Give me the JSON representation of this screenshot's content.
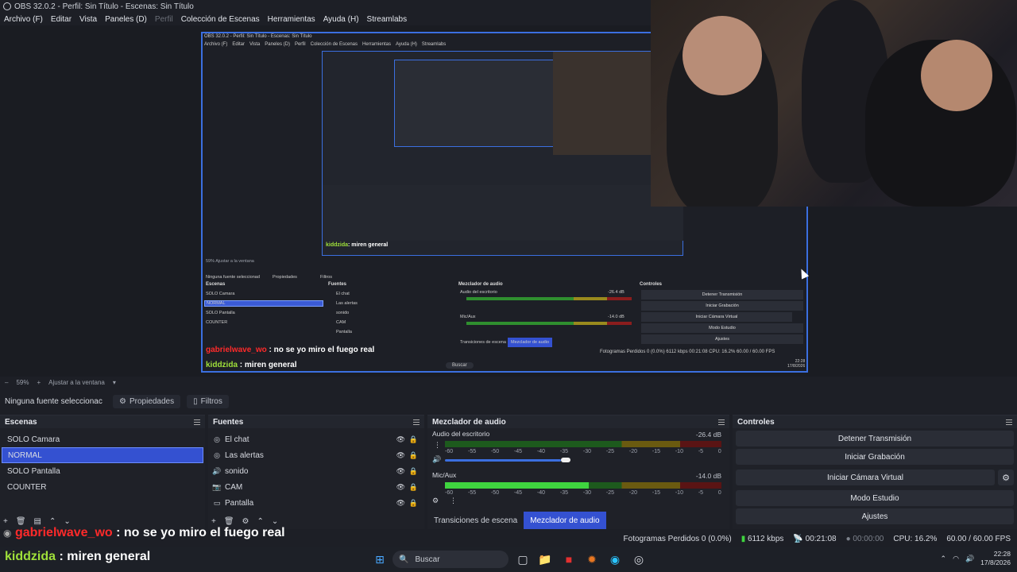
{
  "window": {
    "title": "OBS 32.0.2 - Perfil: Sin Título - Escenas: Sin Título"
  },
  "menu": [
    {
      "label": "Archivo (F)",
      "disabled": false
    },
    {
      "label": "Editar",
      "disabled": false
    },
    {
      "label": "Vista",
      "disabled": false
    },
    {
      "label": "Paneles (D)",
      "disabled": false
    },
    {
      "label": "Perfil",
      "disabled": true
    },
    {
      "label": "Colección de Escenas",
      "disabled": false
    },
    {
      "label": "Herramientas",
      "disabled": false
    },
    {
      "label": "Ayuda (H)",
      "disabled": false
    },
    {
      "label": "Streamlabs",
      "disabled": false
    }
  ],
  "nested": {
    "title": "OBS 32.0.2 - Perfil: Sin Título - Escenas: Sin Título",
    "menu": [
      "Archivo (F)",
      "Editar",
      "Vista",
      "Paneles (D)",
      "Perfil",
      "Colección de Escenas",
      "Herramientas",
      "Ayuda (H)",
      "Streamlabs"
    ],
    "zoom": "59%",
    "fit": "Ajustar a la ventana",
    "no_source": "Ninguna fuente seleccionad",
    "props": "Propiedades",
    "filters": "Filtros",
    "scenes_title": "Escenas",
    "scenes": [
      "SOLO Camara",
      "NORMAL",
      "SOLO Pantalla",
      "COUNTER"
    ],
    "sources_title": "Fuentes",
    "sources": [
      "El chat",
      "Las alertas",
      "sonido",
      "CAM",
      "Pantalla"
    ],
    "mixer_title": "Mezclador de audio",
    "desktop_audio": "Audio del escritorio",
    "desktop_db": "-26.4 dB",
    "mic": "Mic/Aux",
    "mic_db": "-14.0 dB",
    "tab_transitions": "Transiciones de escena",
    "tab_mixer": "Mezclador de audio",
    "controls_title": "Controles",
    "controls": [
      "Detener Transmisión",
      "Iniciar Grabación",
      "Iniciar Cámara Virtual",
      "Modo Estudio",
      "Ajustes"
    ],
    "chat1_user": "gabrielwave_wo",
    "chat1_msg": ": no se yo miro el fuego real",
    "chat2_user": "kiddzida",
    "chat2_msg": ": miren general",
    "status": "Fotogramas Perdidos 0 (0.0%)   6112 kbps   00:21:08   CPU: 16.2%   60.00 / 60.00 FPS",
    "search": "Buscar",
    "time": "22:28",
    "date": "17/8/2026"
  },
  "zoombar": {
    "zoom": "59%",
    "plus": "+",
    "minus": "–",
    "fit": "Ajustar a la ventana"
  },
  "source_toolbar": {
    "no_source": "Ninguna fuente seleccionac",
    "properties": "Propiedades",
    "filters": "Filtros"
  },
  "scenes": {
    "title": "Escenas",
    "items": [
      "SOLO Camara",
      "NORMAL",
      "SOLO Pantalla",
      "COUNTER"
    ],
    "selected_index": 1
  },
  "sources": {
    "title": "Fuentes",
    "items": [
      {
        "label": "El chat",
        "icon": "browser-icon"
      },
      {
        "label": "Las alertas",
        "icon": "browser-icon"
      },
      {
        "label": "sonido",
        "icon": "speaker-icon"
      },
      {
        "label": "CAM",
        "icon": "camera-icon"
      },
      {
        "label": "Pantalla",
        "icon": "monitor-icon"
      }
    ]
  },
  "mixer": {
    "title": "Mezclador de audio",
    "channels": [
      {
        "name": "Audio del escritorio",
        "db": "-26.4 dB",
        "level": 0.0,
        "volume": 0.6
      },
      {
        "name": "Mic/Aux",
        "db": "-14.0 dB",
        "level": 0.52,
        "volume": 0.0
      }
    ],
    "ticks": [
      "-60",
      "-55",
      "-50",
      "-45",
      "-40",
      "-35",
      "-30",
      "-25",
      "-20",
      "-15",
      "-10",
      "-5",
      "0"
    ],
    "tabs": [
      {
        "label": "Transiciones de escena",
        "active": false
      },
      {
        "label": "Mezclador de audio",
        "active": true
      }
    ]
  },
  "controls": {
    "title": "Controles",
    "stop_stream": "Detener Transmisión",
    "start_recording": "Iniciar Grabación",
    "start_virtual_cam": "Iniciar Cámara Virtual",
    "studio_mode": "Modo Estudio",
    "settings": "Ajustes"
  },
  "status": {
    "dropped_frames": "Fotogramas Perdidos 0 (0.0%)",
    "bitrate": "6112 kbps",
    "stream_time": "00:21:08",
    "rec_time": "00:00:00",
    "cpu": "CPU: 16.2%",
    "fps": "60.00 / 60.00 FPS"
  },
  "chat": [
    {
      "user": "gabrielwave_wo",
      "message": ": no se yo miro el fuego real"
    },
    {
      "user": "kiddzida",
      "message": ": miren general"
    }
  ],
  "taskbar": {
    "search": "Buscar",
    "time": "22:28",
    "date": "17/8/2026"
  },
  "colors": {
    "accent": "#3451d1",
    "meter_green": "#3fd43f",
    "chat_red": "#ff2a2a",
    "chat_green": "#9fe03a"
  }
}
